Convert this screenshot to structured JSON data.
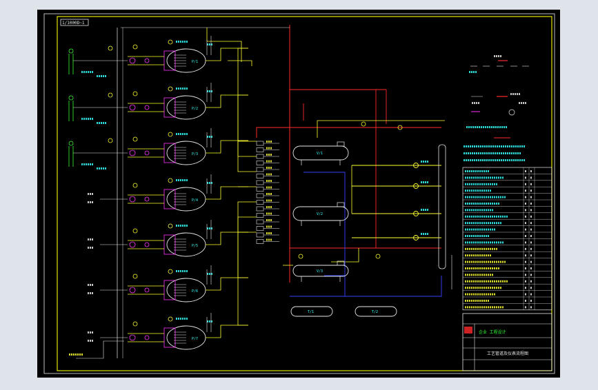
{
  "scale_label": "1/1000D~1",
  "pumps": [
    {
      "label": "P/1"
    },
    {
      "label": "P/2"
    },
    {
      "label": "P/3"
    },
    {
      "label": "P/4"
    },
    {
      "label": "P/5"
    },
    {
      "label": "P/6"
    },
    {
      "label": "P/7"
    }
  ],
  "vessels": [
    {
      "label": "V/1"
    },
    {
      "label": "V/2"
    },
    {
      "label": "V/3"
    },
    {
      "label": "T/1"
    },
    {
      "label": "T/2"
    }
  ],
  "title_block": {
    "company": "企业 工程设计",
    "drawing": "工艺管道及仪表流程图"
  },
  "colors": {
    "background": "#000000",
    "frame": "#e6e600",
    "process_line": "#ffff33",
    "red_line": "#ff2a2a",
    "magenta_line": "#ff33ff",
    "cyan_text": "#33ffff",
    "blue_line": "#3344ff",
    "white_line": "#e8e8e8",
    "green": "#33ff33"
  }
}
